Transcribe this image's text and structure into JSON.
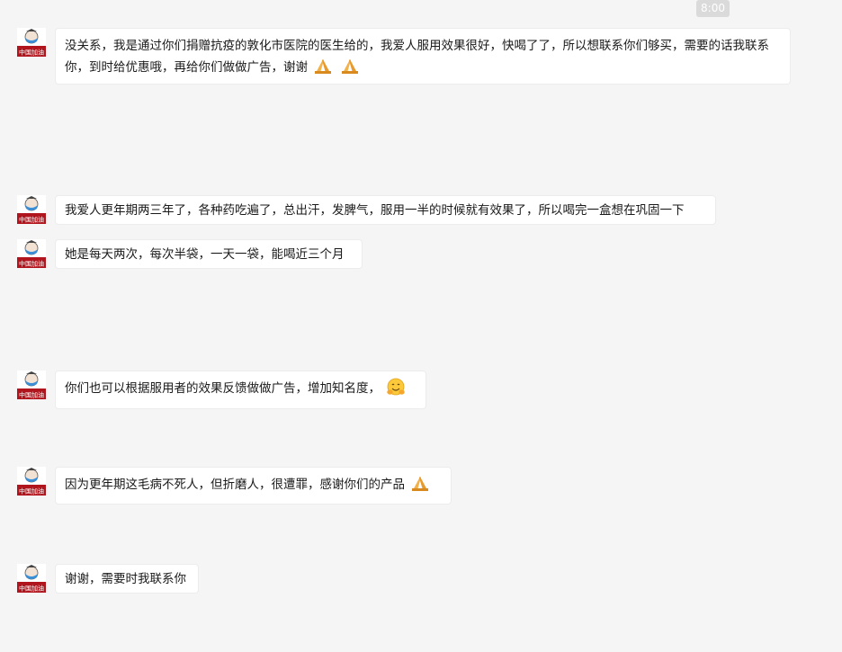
{
  "window": {
    "timestamp": "8:00"
  },
  "avatar": {
    "caption": "中国加油"
  },
  "messages": [
    {
      "text": "没关系，我是通过你们捐赠抗疫的敦化市医院的医生给的，我爱人服用效果很好，快喝了了，所以想联系你们够买，需要的话我联系你，到时给优惠哦，再给你们做做广告，谢谢",
      "emojis": [
        "folded-hands-icon",
        "folded-hands-icon"
      ]
    },
    {
      "text": "我爱人更年期两三年了，各种药吃遍了，总出汗，发脾气，服用一半的时候就有效果了，所以喝完一盒想在巩固一下",
      "emojis": []
    },
    {
      "text": "她是每天两次，每次半袋，一天一袋，能喝近三个月",
      "emojis": []
    },
    {
      "text": "你们也可以根据服用者的效果反馈做做广告，增加知名度，",
      "emojis": [
        "hugging-face-icon"
      ]
    },
    {
      "text": "因为更年期这毛病不死人，但折磨人，很遭罪，感谢你们的产品",
      "emojis": [
        "folded-hands-icon"
      ]
    },
    {
      "text": "谢谢，需要时我联系你",
      "emojis": []
    }
  ],
  "colors": {
    "background": "#f5f5f5",
    "bubble": "#ffffff",
    "timestamp_bg": "#dadada",
    "avatar_banner": "#b0141c",
    "avatar_mask": "#3b8fd6"
  }
}
